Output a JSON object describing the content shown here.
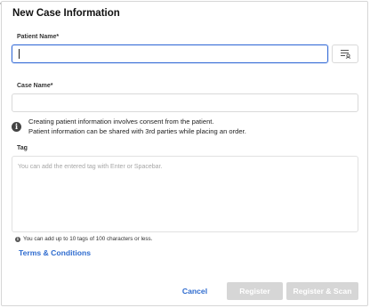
{
  "dialog": {
    "title": "New Case Information",
    "corner_mark": "*"
  },
  "patient_name": {
    "label": "Patient Name*",
    "value": ""
  },
  "patient_list_button": {
    "icon": "patient-list-icon"
  },
  "case_name": {
    "label": "Case Name*",
    "value": ""
  },
  "info": {
    "line1": "Creating patient information involves consent from the patient.",
    "line2": "Patient information can be shared with 3rd parties while placing an order.",
    "icon": "info-icon"
  },
  "tag": {
    "label": "Tag",
    "placeholder": "You can add the entered tag with Enter or Spacebar."
  },
  "tag_hint": {
    "text": "You can add up to 10 tags of 100 characters or less.",
    "icon": "info-icon"
  },
  "terms": {
    "label": "Terms & Conditions"
  },
  "footer": {
    "cancel_label": "Cancel",
    "register_label": "Register",
    "register_scan_label": "Register & Scan"
  },
  "colors": {
    "accent": "#2f6ccf",
    "focus_border": "#3a6fd8",
    "disabled_button": "#d6d6d6"
  }
}
